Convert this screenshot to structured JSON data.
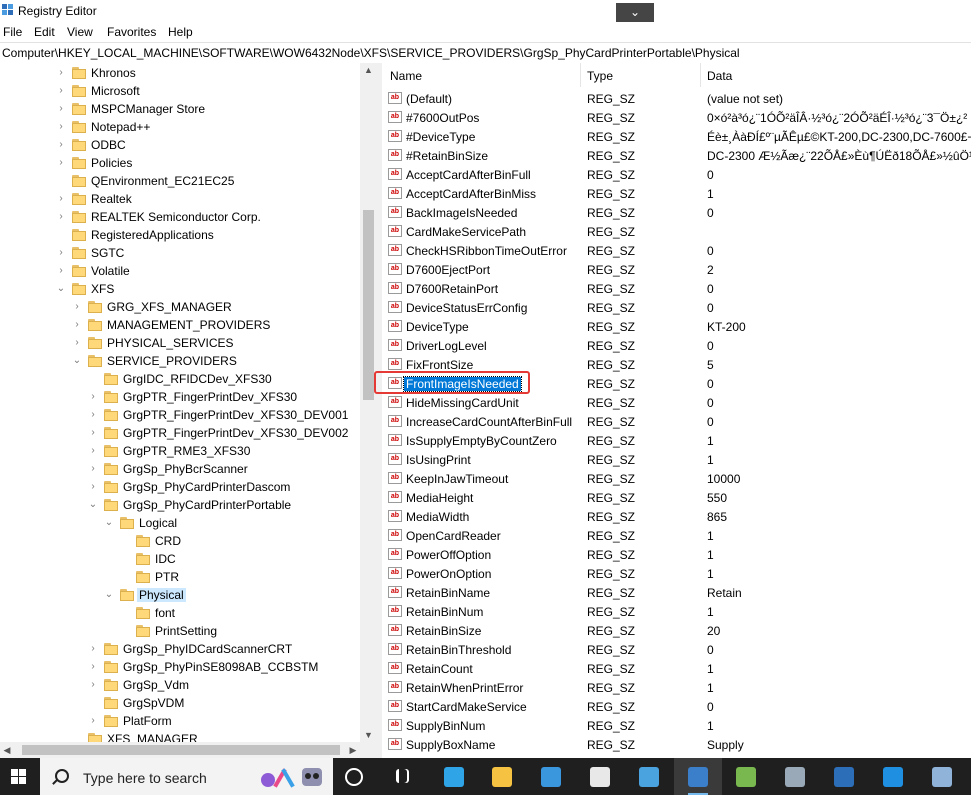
{
  "window": {
    "title": "Registry Editor",
    "dropdown_glyph": "⌄"
  },
  "menu": [
    "File",
    "Edit",
    "View",
    "Favorites",
    "Help"
  ],
  "address": "Computer\\HKEY_LOCAL_MACHINE\\SOFTWARE\\WOW6432Node\\XFS\\SERVICE_PROVIDERS\\GrgSp_PhyCardPrinterPortable\\Physical",
  "tree": [
    {
      "label": "Khronos",
      "level": 0,
      "expander": ">"
    },
    {
      "label": "Microsoft",
      "level": 0,
      "expander": ">"
    },
    {
      "label": "MSPCManager Store",
      "level": 0,
      "expander": ">"
    },
    {
      "label": "Notepad++",
      "level": 0,
      "expander": ">"
    },
    {
      "label": "ODBC",
      "level": 0,
      "expander": ">"
    },
    {
      "label": "Policies",
      "level": 0,
      "expander": ">"
    },
    {
      "label": "QEnvironment_EC21EC25",
      "level": 0,
      "expander": ""
    },
    {
      "label": "Realtek",
      "level": 0,
      "expander": ">"
    },
    {
      "label": "REALTEK Semiconductor Corp.",
      "level": 0,
      "expander": ">"
    },
    {
      "label": "RegisteredApplications",
      "level": 0,
      "expander": ""
    },
    {
      "label": "SGTC",
      "level": 0,
      "expander": ">"
    },
    {
      "label": "Volatile",
      "level": 0,
      "expander": ">"
    },
    {
      "label": "XFS",
      "level": 0,
      "expander": "v"
    },
    {
      "label": "GRG_XFS_MANAGER",
      "level": 1,
      "expander": ">"
    },
    {
      "label": "MANAGEMENT_PROVIDERS",
      "level": 1,
      "expander": ">"
    },
    {
      "label": "PHYSICAL_SERVICES",
      "level": 1,
      "expander": ">"
    },
    {
      "label": "SERVICE_PROVIDERS",
      "level": 1,
      "expander": "v"
    },
    {
      "label": "GrgIDC_RFIDCDev_XFS30",
      "level": 2,
      "expander": ""
    },
    {
      "label": "GrgPTR_FingerPrintDev_XFS30",
      "level": 2,
      "expander": ">"
    },
    {
      "label": "GrgPTR_FingerPrintDev_XFS30_DEV001",
      "level": 2,
      "expander": ">"
    },
    {
      "label": "GrgPTR_FingerPrintDev_XFS30_DEV002",
      "level": 2,
      "expander": ">"
    },
    {
      "label": "GrgPTR_RME3_XFS30",
      "level": 2,
      "expander": ">"
    },
    {
      "label": "GrgSp_PhyBcrScanner",
      "level": 2,
      "expander": ">"
    },
    {
      "label": "GrgSp_PhyCardPrinterDascom",
      "level": 2,
      "expander": ">"
    },
    {
      "label": "GrgSp_PhyCardPrinterPortable",
      "level": 2,
      "expander": "v"
    },
    {
      "label": "Logical",
      "level": 3,
      "expander": "v"
    },
    {
      "label": "CRD",
      "level": 4,
      "expander": ""
    },
    {
      "label": "IDC",
      "level": 4,
      "expander": ""
    },
    {
      "label": "PTR",
      "level": 4,
      "expander": ""
    },
    {
      "label": "Physical",
      "level": 3,
      "expander": "v",
      "selected": true
    },
    {
      "label": "font",
      "level": 4,
      "expander": ""
    },
    {
      "label": "PrintSetting",
      "level": 4,
      "expander": ""
    },
    {
      "label": "GrgSp_PhyIDCardScannerCRT",
      "level": 2,
      "expander": ">"
    },
    {
      "label": "GrgSp_PhyPinSE8098AB_CCBSTM",
      "level": 2,
      "expander": ">"
    },
    {
      "label": "GrgSp_Vdm",
      "level": 2,
      "expander": ">"
    },
    {
      "label": "GrgSpVDM",
      "level": 2,
      "expander": ""
    },
    {
      "label": "PlatForm",
      "level": 2,
      "expander": ">"
    },
    {
      "label": "XFS_MANAGER",
      "level": 1,
      "expander": ""
    }
  ],
  "columns": {
    "name": "Name",
    "type": "Type",
    "data": "Data"
  },
  "values": [
    {
      "name": "(Default)",
      "type": "REG_SZ",
      "data": "(value not set)"
    },
    {
      "name": "#7600OutPos",
      "type": "REG_SZ",
      "data": "0×ó²à³ó¿¨1ÓÕ²äÎÂ·½³ó¿¨2ÓÕ²äÉÎ·½³ó¿¨3¯Ö±¿²"
    },
    {
      "name": "#DeviceType",
      "type": "REG_SZ",
      "data": "Éè±¸ÀàÐÍ£º¨µÃÊµ£©KT-200,DC-2300,DC-7600£¬"
    },
    {
      "name": "#RetainBinSize",
      "type": "REG_SZ",
      "data": "DC-2300 Æ½Ãæ¿¨22ÕÅ£»Èù¶ÚËð18ÕÅ£»½ûÖ¹Ê"
    },
    {
      "name": "AcceptCardAfterBinFull",
      "type": "REG_SZ",
      "data": "0"
    },
    {
      "name": "AcceptCardAfterBinMiss",
      "type": "REG_SZ",
      "data": "1"
    },
    {
      "name": "BackImageIsNeeded",
      "type": "REG_SZ",
      "data": "0"
    },
    {
      "name": "CardMakeServicePath",
      "type": "REG_SZ",
      "data": ""
    },
    {
      "name": "CheckHSRibbonTimeOutError",
      "type": "REG_SZ",
      "data": "0"
    },
    {
      "name": "D7600EjectPort",
      "type": "REG_SZ",
      "data": "2"
    },
    {
      "name": "D7600RetainPort",
      "type": "REG_SZ",
      "data": "0"
    },
    {
      "name": "DeviceStatusErrConfig",
      "type": "REG_SZ",
      "data": "0"
    },
    {
      "name": "DeviceType",
      "type": "REG_SZ",
      "data": "KT-200"
    },
    {
      "name": "DriverLogLevel",
      "type": "REG_SZ",
      "data": "0"
    },
    {
      "name": "FixFrontSize",
      "type": "REG_SZ",
      "data": "5"
    },
    {
      "name": "FrontImageIsNeeded",
      "type": "REG_SZ",
      "data": "0",
      "selected": true
    },
    {
      "name": "HideMissingCardUnit",
      "type": "REG_SZ",
      "data": "0"
    },
    {
      "name": "IncreaseCardCountAfterBinFull",
      "type": "REG_SZ",
      "data": "0"
    },
    {
      "name": "IsSupplyEmptyByCountZero",
      "type": "REG_SZ",
      "data": "1"
    },
    {
      "name": "IsUsingPrint",
      "type": "REG_SZ",
      "data": "1"
    },
    {
      "name": "KeepInJawTimeout",
      "type": "REG_SZ",
      "data": "10000"
    },
    {
      "name": "MediaHeight",
      "type": "REG_SZ",
      "data": "550"
    },
    {
      "name": "MediaWidth",
      "type": "REG_SZ",
      "data": "865"
    },
    {
      "name": "OpenCardReader",
      "type": "REG_SZ",
      "data": "1"
    },
    {
      "name": "PowerOffOption",
      "type": "REG_SZ",
      "data": "1"
    },
    {
      "name": "PowerOnOption",
      "type": "REG_SZ",
      "data": "1"
    },
    {
      "name": "RetainBinName",
      "type": "REG_SZ",
      "data": "Retain"
    },
    {
      "name": "RetainBinNum",
      "type": "REG_SZ",
      "data": "1"
    },
    {
      "name": "RetainBinSize",
      "type": "REG_SZ",
      "data": "20"
    },
    {
      "name": "RetainBinThreshold",
      "type": "REG_SZ",
      "data": "0"
    },
    {
      "name": "RetainCount",
      "type": "REG_SZ",
      "data": "1"
    },
    {
      "name": "RetainWhenPrintError",
      "type": "REG_SZ",
      "data": "1"
    },
    {
      "name": "StartCardMakeService",
      "type": "REG_SZ",
      "data": "0"
    },
    {
      "name": "SupplyBinNum",
      "type": "REG_SZ",
      "data": "1"
    },
    {
      "name": "SupplyBoxName",
      "type": "REG_SZ",
      "data": "Supply"
    }
  ],
  "taskbar": {
    "search_placeholder": "Type here to search",
    "icons": [
      {
        "name": "task-view-icon",
        "color": "#ffffff"
      },
      {
        "name": "widgets-icon",
        "color": "#ffffff"
      },
      {
        "name": "edge-icon",
        "color": "#2fa4e7"
      },
      {
        "name": "file-explorer-icon",
        "color": "#f5c242"
      },
      {
        "name": "microsoft-store-icon",
        "color": "#3a96dd"
      },
      {
        "name": "mail-icon",
        "color": "#e8e8e8"
      },
      {
        "name": "contacts-card-icon",
        "color": "#4aa3df"
      },
      {
        "name": "registry-editor-icon",
        "color": "#3b7ec9"
      },
      {
        "name": "notepad-chart-icon",
        "color": "#79b84f"
      },
      {
        "name": "control-panel-icon",
        "color": "#9aa9b8"
      },
      {
        "name": "crd-app-icon",
        "color": "#2c6fb8"
      },
      {
        "name": "app-store-icon",
        "color": "#1e8fe1"
      },
      {
        "name": "remote-desktop-icon",
        "color": "#8fb3d9"
      }
    ]
  }
}
